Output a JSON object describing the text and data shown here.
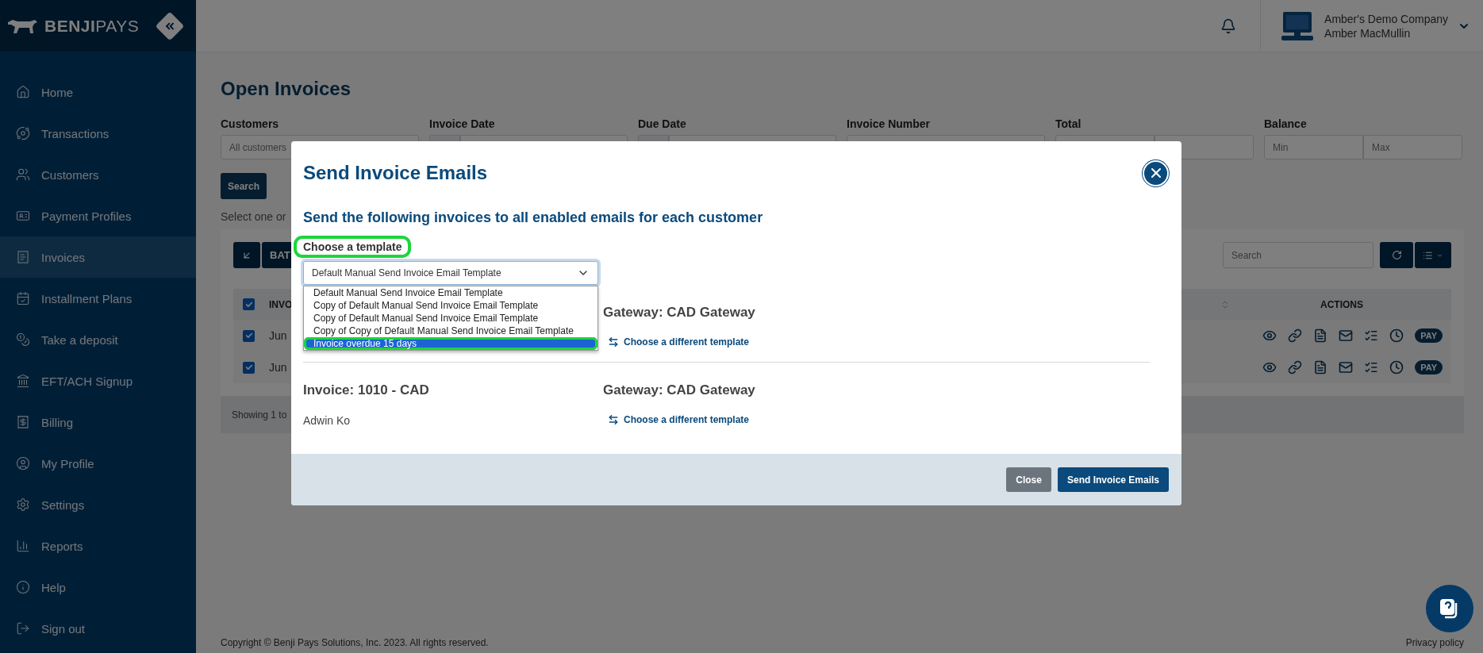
{
  "sidebar": {
    "logo": {
      "bold": "BENJI",
      "light": "PAYS"
    },
    "items": [
      {
        "label": "Home",
        "selected": false
      },
      {
        "label": "Transactions",
        "selected": false
      },
      {
        "label": "Customers",
        "selected": false
      },
      {
        "label": "Payment Profiles",
        "selected": false
      },
      {
        "label": "Invoices",
        "selected": true
      },
      {
        "label": "Installment Plans",
        "selected": false
      },
      {
        "label": "Take a deposit",
        "selected": false
      },
      {
        "label": "EFT/ACH Signup",
        "selected": false
      },
      {
        "label": "Billing",
        "selected": false
      },
      {
        "label": "My Profile",
        "selected": false
      },
      {
        "label": "Settings",
        "selected": false
      },
      {
        "label": "Reports",
        "selected": false
      },
      {
        "label": "Help",
        "selected": false
      },
      {
        "label": "Sign out",
        "selected": false
      }
    ]
  },
  "header": {
    "company": "Amber's Demo Company",
    "user": "Amber MacMullin"
  },
  "page": {
    "title": "Open Invoices",
    "filters": [
      {
        "label": "Customers",
        "kind": "text",
        "placeholder": "All customers"
      },
      {
        "label": "Invoice Date",
        "kind": "date"
      },
      {
        "label": "Due Date",
        "kind": "date"
      },
      {
        "label": "Invoice Number",
        "kind": "text"
      },
      {
        "label": "Total",
        "kind": "range"
      },
      {
        "label": "Balance",
        "kind": "range",
        "placeholders": [
          "Min",
          "Max"
        ]
      }
    ],
    "search_button": "Search",
    "hint": "Select one or"
  },
  "table": {
    "batch_button": "BAT",
    "search_placeholder": "Search",
    "header": {
      "checked": true,
      "first_column": "INVO",
      "actions": "ACTIONS"
    },
    "rows": [
      {
        "checked": true,
        "first_cell": "Jun",
        "pay": "PAY"
      },
      {
        "checked": true,
        "first_cell": "Jun",
        "pay": "PAY"
      }
    ],
    "footer": "Showing 1 to"
  },
  "modal": {
    "title": "Send Invoice Emails",
    "subtitle": "Send the following invoices to all enabled emails for each customer",
    "template_label": {
      "text": "Choose a template",
      "highlighted": true
    },
    "select_value": "Default Manual Send Invoice Email Template",
    "options": [
      {
        "label": "Default Manual Send Invoice Email Template",
        "selected": false,
        "highlighted": false
      },
      {
        "label": "Copy of Default Manual Send Invoice Email Template",
        "selected": false,
        "highlighted": false
      },
      {
        "label": "Copy of Default Manual Send Invoice Email Template",
        "selected": false,
        "highlighted": false
      },
      {
        "label": "Copy of Copy of Default Manual Send Invoice Email Template",
        "selected": false,
        "highlighted": false
      },
      {
        "label": "Invoice overdue 15 days",
        "selected": true,
        "highlighted": true
      }
    ],
    "invoices": [
      {
        "gateway": "Gateway: CAD Gateway",
        "link": "Choose a different template"
      },
      {
        "invoice": "Invoice: 1010 - CAD",
        "customer": "Adwin Ko",
        "gateway": "Gateway: CAD Gateway",
        "link": "Choose a different template"
      }
    ],
    "buttons": [
      {
        "label": "Close",
        "kind": "secondary"
      },
      {
        "label": "Send Invoice Emails",
        "kind": "primary"
      }
    ]
  },
  "footer": {
    "copyright": "Copyright © Benji Pays Solutions, Inc. 2023. All rights reserved.",
    "privacy": "Privacy policy"
  }
}
